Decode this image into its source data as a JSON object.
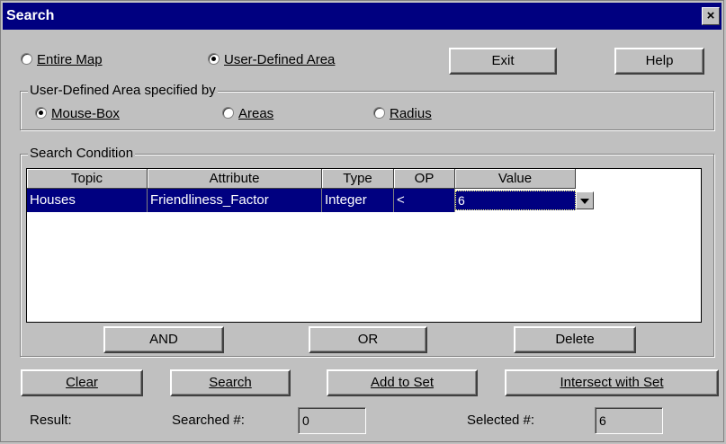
{
  "window": {
    "title": "Search",
    "close_label": "×"
  },
  "area": {
    "entire_map": "Entire Map",
    "user_defined": "User-Defined Area",
    "selected": "user_defined"
  },
  "top_buttons": {
    "exit": "Exit",
    "help": "Help"
  },
  "specified_by": {
    "legend": "User-Defined Area specified by",
    "mouse_box": "Mouse-Box",
    "areas": "Areas",
    "radius": "Radius",
    "selected": "mouse_box"
  },
  "condition": {
    "legend": "Search Condition",
    "columns": [
      "Topic",
      "Attribute",
      "Type",
      "OP",
      "Value"
    ],
    "rows": [
      {
        "topic": "Houses",
        "attribute": "Friendliness_Factor",
        "type": "Integer",
        "op": "<",
        "value": "6"
      }
    ],
    "and_label": "AND",
    "or_label": "OR",
    "delete_label": "Delete"
  },
  "actions": {
    "clear": "Clear",
    "search": "Search",
    "add_to_set": "Add to Set",
    "intersect": "Intersect with Set"
  },
  "result": {
    "label": "Result:",
    "searched_label": "Searched #:",
    "searched_value": "0",
    "selected_label": "Selected #:",
    "selected_value": "6"
  }
}
